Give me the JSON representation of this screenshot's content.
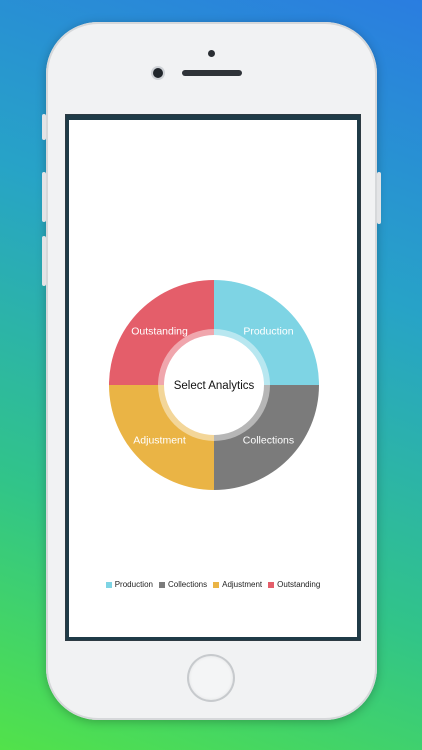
{
  "chart_data": {
    "type": "pie",
    "center_label": "Select Analytics",
    "categories": [
      "Production",
      "Collections",
      "Adjustment",
      "Outstanding"
    ],
    "values": [
      25,
      25,
      25,
      25
    ],
    "colors": [
      "#7ed4e4",
      "#7b7b7b",
      "#eab445",
      "#e45e6a"
    ],
    "legend_position": "bottom"
  },
  "legend": {
    "items": [
      {
        "label": "Production",
        "color": "#7ed4e4"
      },
      {
        "label": "Collections",
        "color": "#7b7b7b"
      },
      {
        "label": "Adjustment",
        "color": "#eab445"
      },
      {
        "label": "Outstanding",
        "color": "#e45e6a"
      }
    ]
  }
}
